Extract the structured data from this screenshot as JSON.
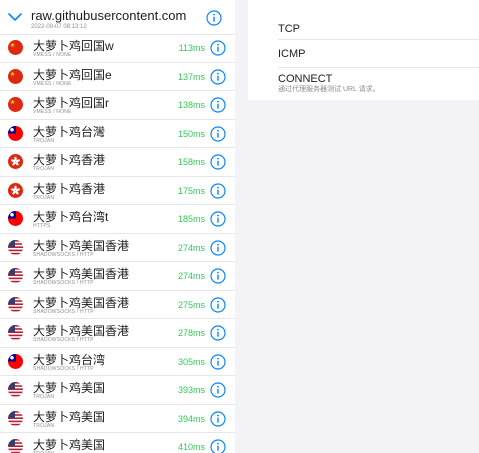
{
  "source": {
    "title": "raw.githubusercontent.com",
    "date": "2022-09-07 08:13:12"
  },
  "proxies": [
    {
      "name": "大萝卜鸡回国w",
      "type": "VMESS / NONE",
      "latency": "113ms",
      "flag": "cn"
    },
    {
      "name": "大萝卜鸡回国e",
      "type": "VMESS / NONE",
      "latency": "137ms",
      "flag": "cn"
    },
    {
      "name": "大萝卜鸡回国r",
      "type": "VMESS / NONE",
      "latency": "138ms",
      "flag": "cn"
    },
    {
      "name": "大萝卜鸡台灣",
      "type": "TROJAN",
      "latency": "150ms",
      "flag": "tw"
    },
    {
      "name": "大萝卜鸡香港",
      "type": "TROJAN",
      "latency": "158ms",
      "flag": "hk"
    },
    {
      "name": "大萝卜鸡香港",
      "type": "TROJAN",
      "latency": "175ms",
      "flag": "hk"
    },
    {
      "name": "大萝卜鸡台湾t",
      "type": "HTTPS",
      "latency": "185ms",
      "flag": "tw"
    },
    {
      "name": "大萝卜鸡美国香港",
      "type": "SHADOWSOCKS / HTTP",
      "latency": "274ms",
      "flag": "us"
    },
    {
      "name": "大萝卜鸡美国香港",
      "type": "SHADOWSOCKS / HTTP",
      "latency": "274ms",
      "flag": "us"
    },
    {
      "name": "大萝卜鸡美国香港",
      "type": "SHADOWSOCKS / HTTP",
      "latency": "275ms",
      "flag": "us"
    },
    {
      "name": "大萝卜鸡美国香港",
      "type": "SHADOWSOCKS / HTTP",
      "latency": "278ms",
      "flag": "us"
    },
    {
      "name": "大萝卜鸡台湾",
      "type": "SHADOWSOCKS / HTTP",
      "latency": "305ms",
      "flag": "tw"
    },
    {
      "name": "大萝卜鸡美国",
      "type": "TROJAN",
      "latency": "393ms",
      "flag": "us"
    },
    {
      "name": "大萝卜鸡美国",
      "type": "TROJAN",
      "latency": "394ms",
      "flag": "us"
    },
    {
      "name": "大萝卜鸡美国",
      "type": "TROJAN",
      "latency": "410ms",
      "flag": "us"
    }
  ],
  "test_methods": {
    "tcp_label": "TCP",
    "icmp_label": "ICMP",
    "connect_label": "CONNECT",
    "connect_desc": "通过代理服务器测试 URL 请求。"
  },
  "colors": {
    "accent": "#0a84ff",
    "latency": "#34c759"
  }
}
